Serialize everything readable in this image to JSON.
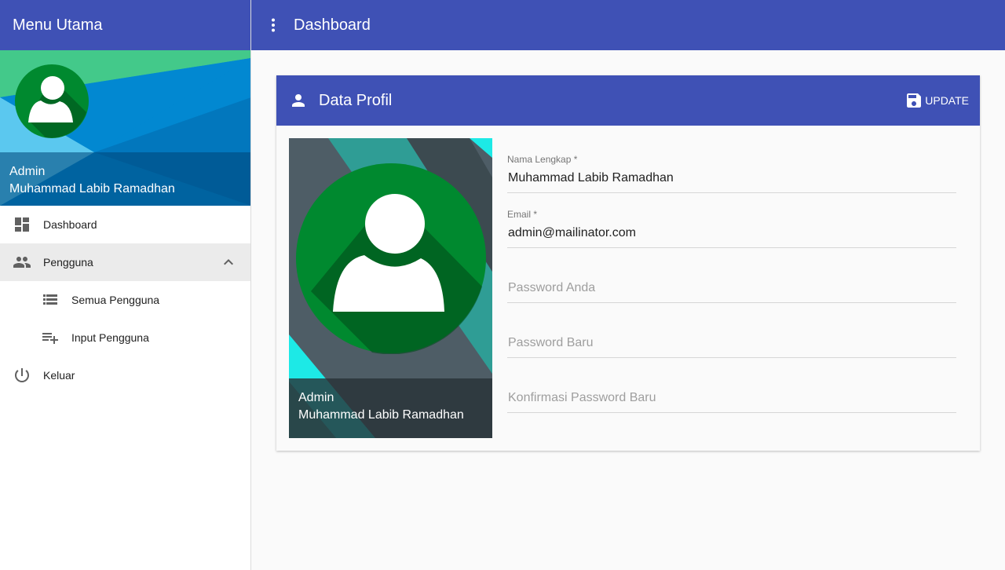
{
  "sidebar": {
    "title": "Menu Utama",
    "profile": {
      "role": "Admin",
      "name": "Muhammad Labib Ramadhan"
    },
    "items": [
      {
        "label": "Dashboard",
        "icon": "dashboard-icon"
      },
      {
        "label": "Pengguna",
        "icon": "people-icon",
        "expanded": true
      },
      {
        "label": "Semua Pengguna",
        "icon": "list-icon"
      },
      {
        "label": "Input Pengguna",
        "icon": "playlist-add-icon"
      },
      {
        "label": "Keluar",
        "icon": "power-icon"
      }
    ]
  },
  "topbar": {
    "title": "Dashboard"
  },
  "card": {
    "title": "Data Profil",
    "update_label": "UPDATE",
    "photo": {
      "role": "Admin",
      "name": "Muhammad Labib Ramadhan"
    },
    "fields": {
      "nama": {
        "label": "Nama Lengkap *",
        "value": "Muhammad Labib Ramadhan"
      },
      "email": {
        "label": "Email *",
        "value": "admin@mailinator.com"
      },
      "password": {
        "placeholder": "Password Anda"
      },
      "password_baru": {
        "placeholder": "Password Baru"
      },
      "konfirmasi": {
        "placeholder": "Konfirmasi Password Baru"
      }
    }
  },
  "colors": {
    "primary": "#3f51b5",
    "avatar_green": "#00892f",
    "avatar_shadow": "#004d1a"
  }
}
